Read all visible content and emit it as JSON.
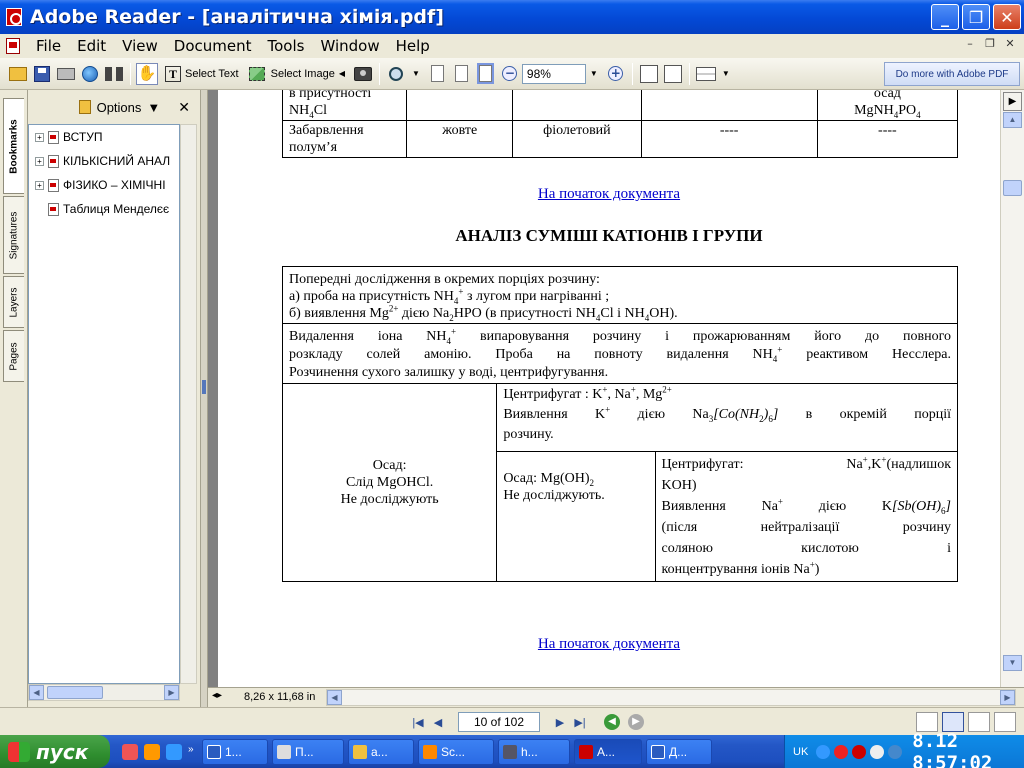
{
  "window": {
    "title": "Adobe Reader - [аналітична хімія.pdf]",
    "min": "_",
    "max": "❐",
    "close": "✕"
  },
  "menu": [
    "File",
    "Edit",
    "View",
    "Document",
    "Tools",
    "Window",
    "Help"
  ],
  "toolbar": {
    "select_text": "Select Text",
    "select_image": "Select Image",
    "zoom": "98%",
    "adobe_pdf": "Do more with Adobe PDF"
  },
  "navtabs": [
    "Bookmarks",
    "Signatures",
    "Layers",
    "Pages"
  ],
  "bookmarks": {
    "options_label": "Options",
    "items": [
      {
        "label": "ВСТУП",
        "expandable": true
      },
      {
        "label": "КІЛЬКІСНИЙ АНАЛ",
        "expandable": true
      },
      {
        "label": "ФІЗИКО – ХІМІЧНІ",
        "expandable": true
      },
      {
        "label": "Таблиця Менделєє",
        "expandable": false
      }
    ]
  },
  "document": {
    "top_table": {
      "row1": {
        "col1_a": "в присутності",
        "col1_b": "NH",
        "col1_sub": "4",
        "col1_c": "Cl",
        "col5_a": "осад",
        "col5_b": "MgNH",
        "col5_sub1": "4",
        "col5_c": "PO",
        "col5_sub2": "4"
      },
      "row2": {
        "col1": "Забарвлення полум’я",
        "col2": "жовте",
        "col3": "фіолетовий",
        "col4": "----",
        "col5": "----"
      }
    },
    "link_top": "На початок документа",
    "heading": "АНАЛІЗ СУМІШІ КАТІОНІВ І ГРУПИ",
    "main_table": {
      "r1": {
        "line1": "Попередні дослідження в окремих порціях розчину:",
        "line2a": "а) проба на присутність NH",
        "line2sub": "4",
        "line2sup": "+",
        "line2b": " з лугом при нагріванні ;",
        "line3a": "б) виявлення Mg",
        "line3sup": "2+",
        "line3b": " дією Na",
        "line3sub": "2",
        "line3c": "HPO (в присутності  NH",
        "line3sub2": "4",
        "line3d": "Cl  і  NH",
        "line3sub3": "4",
        "line3e": "OH)."
      },
      "r2": {
        "line1a": "Видалення іона NH",
        "line1sub": "4",
        "line1sup": "+",
        "line1b": " випаровування розчину і прожарюванням його до повного",
        "line2a": "розкладу солей амонію. Проба на повноту видалення NH",
        "line2sub": "4",
        "line2sup": "+",
        "line2b": "  реактивом Несслера.",
        "line3": "Розчинення сухого залишку у воді, центрифугування."
      },
      "left": {
        "l1": "Осад:",
        "l2": "Слід MgOHCl.",
        "l3": "Не досліджують"
      },
      "centrifugate1": {
        "l1a": "Центрифугат : K",
        "l1sup1": "+",
        "l1b": ", Na",
        "l1sup2": "+",
        "l1c": ", Mg",
        "l1sup3": "2+",
        "l2a": "Виявлення  K",
        "l2sup": "+",
        "l2b": "  дією  Na",
        "l2sub": "3",
        "l2formula": "[Co(NH",
        "l2fsub": "2",
        "l2formula2": ")",
        "l2fsub2": "6",
        "l2formula3": "]",
        "l2c": "  в  окремій  порції",
        "l3": "розчину."
      },
      "sediment2": {
        "l1a": "Осад: Mg(OH)",
        "l1sub": "2",
        "l2": "Не досліджують."
      },
      "centrifugate2": {
        "l1a": "Центрифугат:",
        "l1b": "Na",
        "l1sup1": "+",
        "l1c": ",K",
        "l1sup2": "+",
        "l1d": "(надлишок",
        "l2": "KOH)",
        "l3a": "Виявлення  Na",
        "l3sup": "+",
        "l3b": "  дією  K",
        "l3formula": "[Sb(OH)",
        "l3fsub": "6",
        "l3formula2": "]",
        "l4": "(після     нейтралізації     розчину",
        "l5": "соляною           кислотою           і",
        "l6a": "концентрування іонів Na",
        "l6sup": "+",
        "l6b": ")"
      }
    },
    "link_bottom": "На початок документа"
  },
  "statusbar": {
    "page_size": "8,26 x 11,68 in",
    "page_indicator": "10 of 102"
  },
  "taskbar": {
    "start": "пуск",
    "tasks": [
      "1...",
      "П...",
      "а...",
      "Sc...",
      "h...",
      "А...",
      "Д..."
    ],
    "lang": "UK",
    "clock": "8.12  8:57:02"
  }
}
